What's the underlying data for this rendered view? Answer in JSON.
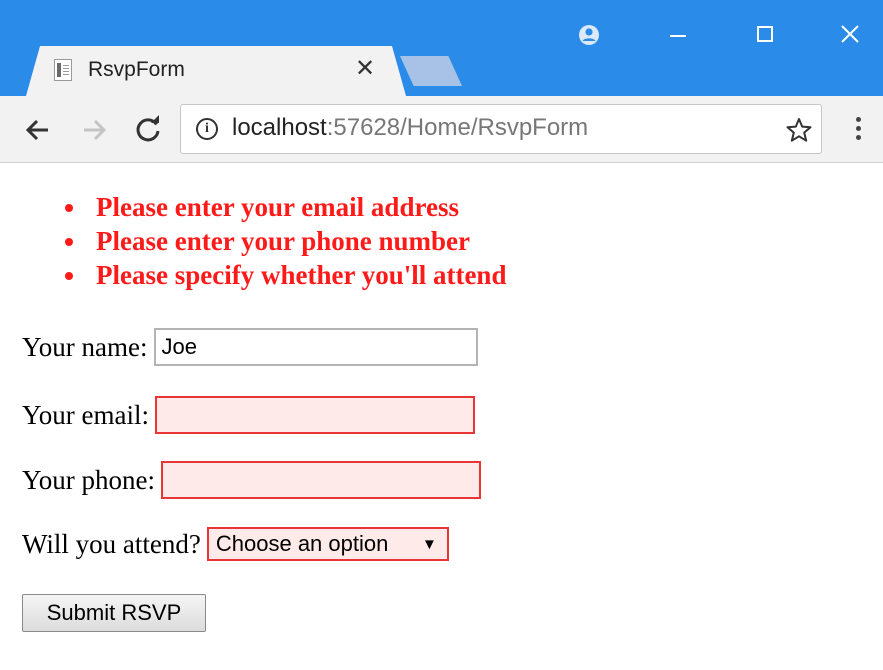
{
  "browser": {
    "tab": {
      "title": "RsvpForm"
    },
    "address_bar": {
      "host": "localhost",
      "path": ":57628/Home/RsvpForm"
    },
    "colors": {
      "titlebar": "#2a8ce8",
      "toolbar": "#f2f2f2"
    }
  },
  "page": {
    "errors": [
      "Please enter your email address",
      "Please enter your phone number",
      "Please specify whether you'll attend"
    ],
    "form": {
      "name": {
        "label": "Your name:",
        "value": "Joe"
      },
      "email": {
        "label": "Your email:",
        "value": ""
      },
      "phone": {
        "label": "Your phone:",
        "value": ""
      },
      "attend": {
        "label": "Will you attend?",
        "selected": "Choose an option"
      },
      "submit_label": "Submit RSVP"
    },
    "colors": {
      "error_text": "#ff1a1a",
      "error_border": "#e83535",
      "error_fill": "#ffeaea"
    }
  }
}
